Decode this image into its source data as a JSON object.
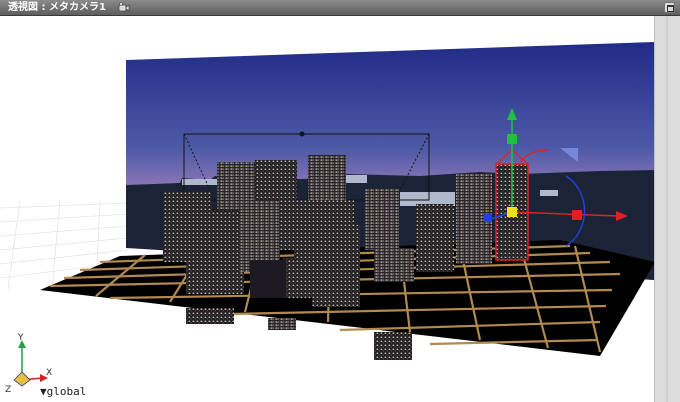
{
  "window": {
    "title": "透視図 : メタカメラ1",
    "title_icon": "camera-icon",
    "max_icon": "window-restore-icon"
  },
  "viewport": {
    "coordinate_label": "▼global",
    "axes": {
      "x": "X",
      "y": "Y",
      "z": "Z"
    },
    "grid_lines": "#b08a50",
    "gizmo_colors": {
      "x": "#e02020",
      "y": "#20c040",
      "z": "#2040e0"
    }
  }
}
